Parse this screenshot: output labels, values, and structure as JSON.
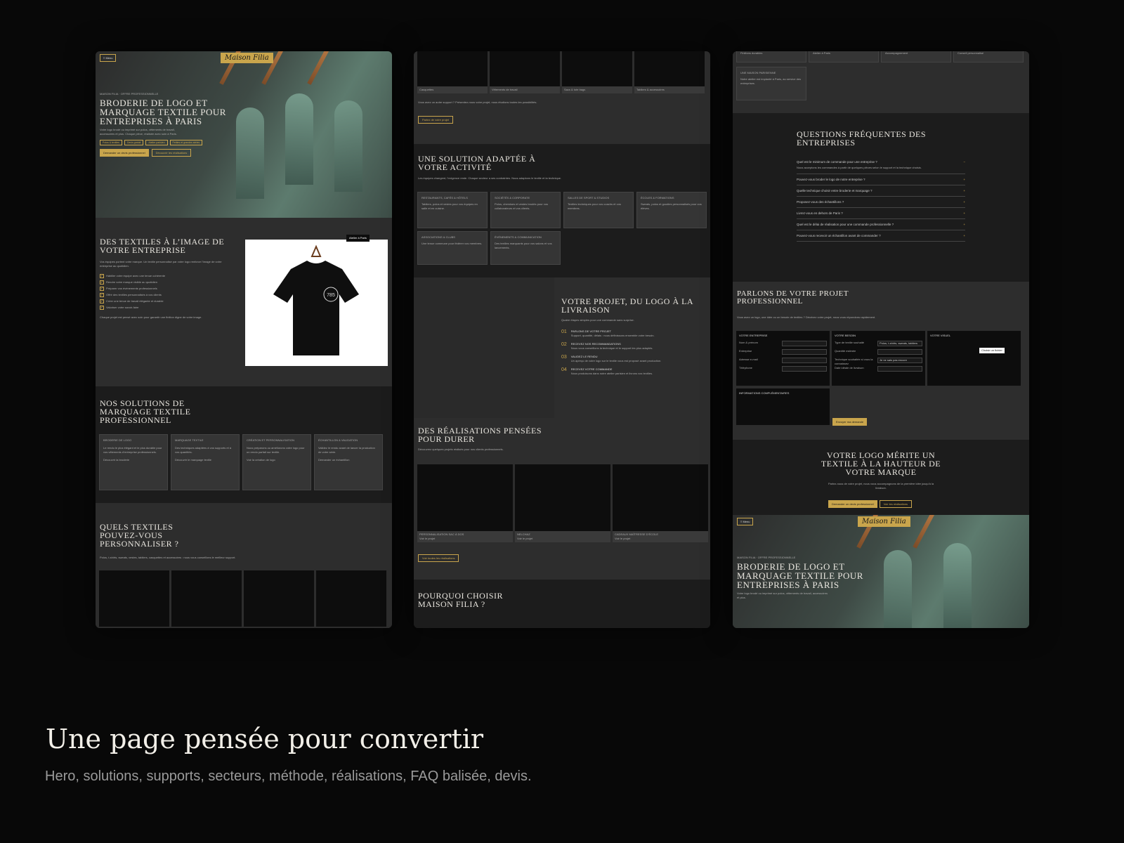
{
  "caption": {
    "title": "Une page pensée pour convertir",
    "subtitle": "Hero, solutions, supports, secteurs, méthode, réalisations, FAQ balisée, devis."
  },
  "brand": {
    "logo": "Maison Filia",
    "menu": "≡ Menu"
  },
  "colors": {
    "gold": "#c9a54c",
    "background": "#080808",
    "panel": "#262626"
  },
  "shot1": {
    "hero": {
      "eyebrow": "MAISON FILIA · OFFRE PROFESSIONNELLE",
      "title": "BRODERIE DE LOGO ET MARQUAGE TEXTILE POUR ENTREPRISES À PARIS",
      "text": "Votre logo brodé ou imprimé sur polos, vêtements de travail, accessoires et plus. Chaque pièce, réalisée avec soin à Paris.",
      "chips": [
        "Polos & textiles",
        "Devis gratuit",
        "Atelier parisien",
        "Petites et grandes séries"
      ],
      "cta_primary": "Demander un devis professionnel",
      "cta_secondary": "Découvrir les réalisations"
    },
    "intro": {
      "title": "DES TEXTILES À L’IMAGE DE VOTRE ENTREPRISE",
      "text": "Vos équipes portent votre marque. Un textile personnalisé par votre logo renforce l’image de votre entreprise au quotidien.",
      "badge": "Atelier à Paris",
      "checklist": [
        "Habiller votre équipe avec une tenue cohérente",
        "Rendre votre marque visible au quotidien",
        "Préparer vos événements professionnels",
        "Offrir des textiles personnalisés à vos clients",
        "Créer une tenue de travail élégante et durable",
        "Valoriser votre savoir-faire"
      ],
      "footnote": "Chaque projet est pensé avec soin pour garantir une finition digne de votre image."
    },
    "solutions": {
      "title": "NOS SOLUTIONS DE MARQUAGE TEXTILE PROFESSIONNEL",
      "cards": [
        {
          "title": "BRODERIE DE LOGO",
          "text": "Le rendu le plus élégant et le plus durable pour vos vêtements d’entreprise professionnels.",
          "link": "Découvrir la broderie"
        },
        {
          "title": "MARQUAGE TEXTILE",
          "text": "Des techniques adaptées à vos supports et à vos quantités.",
          "link": "Découvrir le marquage textile"
        },
        {
          "title": "CRÉATION ET PERSONNALISATION",
          "text": "Nous préparons ou améliorons votre logo pour un rendu parfait sur textile.",
          "link": "Voir la création de logo"
        },
        {
          "title": "ÉCHANTILLON & VALIDATION",
          "text": "Validez le rendu avant de lancer la production de votre série.",
          "link": "Demander un échantillon"
        }
      ]
    },
    "textiles": {
      "title": "QUELS TEXTILES POUVEZ-VOUS PERSONNALISER ?",
      "text": "Polos, t-shirts, sweats, vestes, tabliers, casquettes et accessoires : nous vous conseillons le meilleur support."
    }
  },
  "shot2": {
    "supports": [
      "Casquettes",
      "Vêtements de travail",
      "Sacs & tote bags",
      "Tabliers & accessoires"
    ],
    "supports_note": "Vous avez un autre support ? Présentez-nous votre projet, nous étudions toutes les possibilités.",
    "supports_cta": "Parlez de votre projet",
    "sectors": {
      "title": "UNE SOLUTION ADAPTÉE À VOTRE ACTIVITÉ",
      "text": "Les équipes changent, l’exigence reste. Chaque secteur a ses contraintes. Nous adaptons le textile et la technique.",
      "cards": [
        {
          "title": "RESTAURANTS, CAFÉS & HÔTELS",
          "text": "Tabliers, polos et vestes pour vos équipes en salle et en cuisine."
        },
        {
          "title": "SOCIÉTÉS & CORPORATE",
          "text": "Polos, chemises et vestes brodés pour vos collaborateurs et vos clients."
        },
        {
          "title": "SALLES DE SPORT & STUDIOS",
          "text": "Textiles techniques pour vos coachs et vos membres."
        },
        {
          "title": "ASSOCIATIONS & CLUBS",
          "text": "Une tenue commune pour fédérer vos membres."
        },
        {
          "title": "ÉVÉNEMENTS & COMMUNICATION",
          "text": "Des textiles marquants pour vos salons et vos lancements."
        },
        {
          "title": "ÉCOLES & FORMATIONS",
          "text": "Sweats, polos et goodies personnalisés pour vos élèves."
        }
      ]
    },
    "method": {
      "title": "VOTRE PROJET, DU LOGO À LA LIVRAISON",
      "text": "Quatre étapes simples pour une commande sans surprise.",
      "steps": [
        {
          "n": "01",
          "title": "PARLONS DE VOTRE PROJET",
          "text": "Support, quantité, délais : nous définissons ensemble votre besoin."
        },
        {
          "n": "02",
          "title": "RECEVEZ NOS RECOMMANDATIONS",
          "text": "Nous vous conseillons la technique et le support les plus adaptés."
        },
        {
          "n": "03",
          "title": "VALIDEZ LE RENDU",
          "text": "Un aperçu de votre logo sur le textile vous est proposé avant production."
        },
        {
          "n": "04",
          "title": "RECEVEZ VOTRE COMMANDE",
          "text": "Nous produisons dans notre atelier parisien et livrons vos textiles."
        }
      ]
    },
    "works": {
      "title": "DES RÉALISATIONS PENSÉES POUR DURER",
      "text": "Découvrez quelques projets réalisés pour nos clients professionnels.",
      "items": [
        {
          "name": "PERSONNALISATION SAC À DOS",
          "link": "Voir le projet"
        },
        {
          "name": "NELCHAZ",
          "link": "Voir le projet"
        },
        {
          "name": "CADEAUX MAÎTRESSE D’ÉCOLE",
          "link": "Voir le projet"
        }
      ],
      "cta": "Voir toutes les réalisations"
    },
    "why": {
      "title": "POURQUOI CHOISIR MAISON FILIA ?"
    }
  },
  "shot3": {
    "top_cards": [
      "Finitions durables",
      "Atelier à Paris",
      "Accompagnement",
      "Conseil personnalisé"
    ],
    "paris_card": {
      "title": "UNE MAISON PARISIENNE",
      "text": "Notre atelier est implanté à Paris, au service des entreprises."
    },
    "faq": {
      "title": "QUESTIONS FRÉQUENTES DES ENTREPRISES",
      "open_question": "Quel est le minimum de commande pour une entreprise ?",
      "open_answer": "Nous acceptons les commandes à partir de quelques pièces selon le support et la technique choisis.",
      "questions": [
        "Pouvez-vous broder le logo de notre entreprise ?",
        "Quelle technique choisir entre broderie et marquage ?",
        "Proposez-vous des échantillons ?",
        "Livrez-vous en dehors de Paris ?",
        "Quel est le délai de réalisation pour une commande professionnelle ?",
        "Pouvez-vous recevoir un échantillon avant de commander ?"
      ]
    },
    "contact": {
      "title": "PARLONS DE VOTRE PROJET PROFESSIONNEL",
      "note": "Vous avez un logo, une idée ou un besoin de textiles ? Décrivez votre projet, nous vous répondons rapidement.",
      "col1": "VOTRE ENTREPRISE",
      "col1_fields": [
        "Nom & prénom",
        "Entreprise",
        "Adresse e-mail",
        "Téléphone"
      ],
      "col2": "VOTRE BESOIN",
      "col2_fields": [
        "Type de textile souhaité",
        "Quantité estimée",
        "Technique souhaitée si vous la connaissez",
        "Date idéale de livraison"
      ],
      "col2_select1": "Polos, t-shirts, sweats, tabliers",
      "col2_select2": "Je ne sais pas encore",
      "col3": "VOTRE VISUEL",
      "col3_btn": "Choisir un fichier",
      "details": "INFORMATIONS COMPLÉMENTAIRES",
      "submit": "Envoyer ma demande"
    },
    "cta": {
      "title": "VOTRE LOGO MÉRITE UN TEXTILE À LA HAUTEUR DE VOTRE MARQUE",
      "text": "Parlez-nous de votre projet, nous vous accompagnons de la première idée jusqu’à la livraison.",
      "primary": "Demander un devis professionnel",
      "secondary": "Voir les réalisations"
    },
    "hero": {
      "eyebrow": "MAISON FILIA · OFFRE PROFESSIONNELLE",
      "title": "BRODERIE DE LOGO ET MARQUAGE TEXTILE POUR ENTREPRISES À PARIS",
      "text": "Votre logo brodé ou imprimé sur polos, vêtements de travail, accessoires et plus."
    }
  }
}
